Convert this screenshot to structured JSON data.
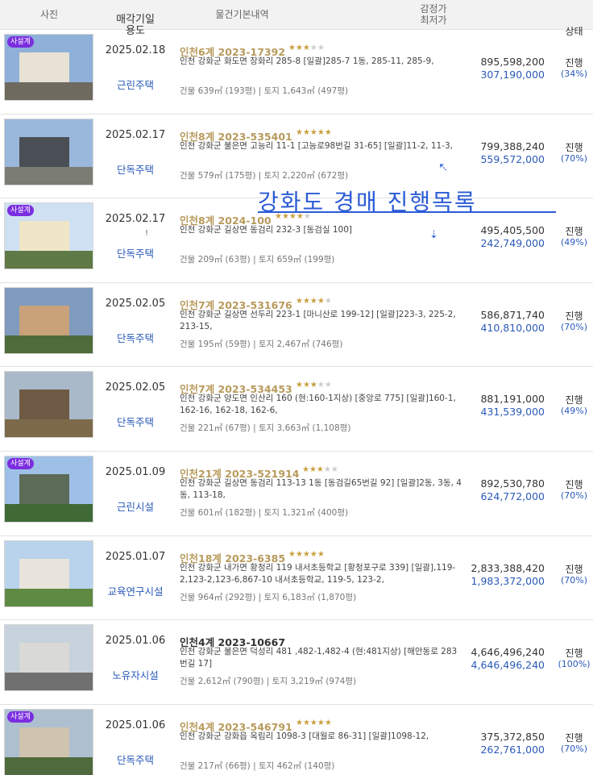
{
  "header": {
    "photo": "사진",
    "date_line1": "매각기일",
    "date_line2": "용도",
    "info": "물건기본내역",
    "price_line1": "감정가",
    "price_line2": "최저가",
    "status": "상태"
  },
  "overlay": {
    "text": "강화도 경매 진행목록"
  },
  "rows": [
    {
      "badge": "사설계",
      "date": "2025.02.18",
      "date_mark": "",
      "usage": "근린주택",
      "title": "인천6계 2023-17392",
      "stars_on": "★★★",
      "stars_off": "★★",
      "address": "인천 강화군 화도면 장화리 285-8 [일괄]285-7 1동, 285-11, 285-9,",
      "area": "건물 639㎡ (193평)  |  토지 1,643㎡ (497평)",
      "appraisal": "895,598,200",
      "minimum": "307,190,000",
      "status": "진행",
      "percent": "(34%)"
    },
    {
      "badge": "",
      "date": "2025.02.17",
      "date_mark": "",
      "usage": "단독주택",
      "title": "인천8계 2023-535401",
      "stars_on": "★★★★★",
      "stars_off": "",
      "address": "인천 강화군 불은면 고능리 11-1 [고능로98번길 31-65] [일괄]11-2, 11-3,",
      "area": "건물 579㎡ (175평)  |  토지 2,220㎡ (672평)",
      "appraisal": "799,388,240",
      "minimum": "559,572,000",
      "status": "진행",
      "percent": "(70%)"
    },
    {
      "badge": "사설계",
      "date": "2025.02.17",
      "date_mark": "!",
      "usage": "단독주택",
      "title": "인천8계 2024-100",
      "stars_on": "★★★★",
      "stars_off": "★",
      "address": "인천 강화군 길상면 동검리 232-3 [동검실 100]",
      "area": "건물 209㎡ (63평)  |  토지 659㎡ (199평)",
      "appraisal": "495,405,500",
      "minimum": "242,749,000",
      "status": "진행",
      "percent": "(49%)"
    },
    {
      "badge": "",
      "date": "2025.02.05",
      "date_mark": "",
      "usage": "단독주택",
      "title": "인천7계 2023-531676",
      "stars_on": "★★★★",
      "stars_off": "★",
      "address": "인천 강화군 길상면 선두리 223-1 [마니산로 199-12] [일괄]223-3, 225-2, 213-15,",
      "area": "건물 195㎡ (59평)  |  토지 2,467㎡ (746평)",
      "appraisal": "586,871,740",
      "minimum": "410,810,000",
      "status": "진행",
      "percent": "(70%)"
    },
    {
      "badge": "",
      "date": "2025.02.05",
      "date_mark": "",
      "usage": "단독주택",
      "title": "인천7계 2023-534453",
      "stars_on": "★★★",
      "stars_off": "★★",
      "address": "인천 강화군 양도면 인산리 160 (현:160-1지상) [중앙로 775] [일괄]160-1, 162-16, 162-18, 162-6,",
      "area": "건물 221㎡ (67평)  |  토지 3,663㎡ (1,108평)",
      "appraisal": "881,191,000",
      "minimum": "431,539,000",
      "status": "진행",
      "percent": "(49%)"
    },
    {
      "badge": "사설계",
      "date": "2025.01.09",
      "date_mark": "",
      "usage": "근린시설",
      "title": "인천21계 2023-521914",
      "stars_on": "★★★",
      "stars_off": "★★",
      "address": "인천 강화군 길상면 동검리 113-13 1동 [동검길65번길 92] [일괄]2동, 3동, 4동, 113-18,",
      "area": "건물 601㎡ (182평)  |  토지 1,321㎡ (400평)",
      "appraisal": "892,530,780",
      "minimum": "624,772,000",
      "status": "진행",
      "percent": "(70%)"
    },
    {
      "badge": "",
      "date": "2025.01.07",
      "date_mark": "",
      "usage": "교육연구시설",
      "title": "인천18계 2023-6385",
      "stars_on": "★★★★★",
      "stars_off": "",
      "address": "인천 강화군 내가면 황청리 119 내서초등학교 [황청포구로 339] [일괄],119-2,123-2,123-6,867-10 내서초등학교, 119-5, 123-2,",
      "area": "건물 964㎡ (292평)  |  토지 6,183㎡ (1,870평)",
      "appraisal": "2,833,388,420",
      "minimum": "1,983,372,000",
      "status": "진행",
      "percent": "(70%)"
    },
    {
      "badge": "",
      "date": "2025.01.06",
      "date_mark": "",
      "usage": "노유자시설",
      "title": "인천4계 2023-10667",
      "stars_on": "",
      "stars_off": "",
      "address": "인천 강화군 불은면 덕성리 481 ,482-1,482-4 (현:481지상) [해안동로 283번길 17]",
      "area": "건물 2,612㎡ (790평)  |  토지 3,219㎡ (974평)",
      "appraisal": "4,646,496,240",
      "minimum": "4,646,496,240",
      "status": "진행",
      "percent": "(100%)"
    },
    {
      "badge": "사설계",
      "date": "2025.01.06",
      "date_mark": "",
      "usage": "단독주택",
      "title": "인천4계 2023-546791",
      "stars_on": "★★★★★",
      "stars_off": "",
      "address": "인천 강화군 강화읍 옥림리 1098-3 [대월로 86-31] [일괄]1098-12,",
      "area": "건물 217㎡ (66평)  |  토지 462㎡ (140평)",
      "appraisal": "375,372,850",
      "minimum": "262,761,000",
      "status": "진행",
      "percent": "(70%)"
    }
  ],
  "colors": {
    "title_gold": "#b89a5c",
    "link_blue": "#2a5ab8",
    "badge_purple": "#7b2ee0",
    "star_gold": "#c9a040"
  }
}
